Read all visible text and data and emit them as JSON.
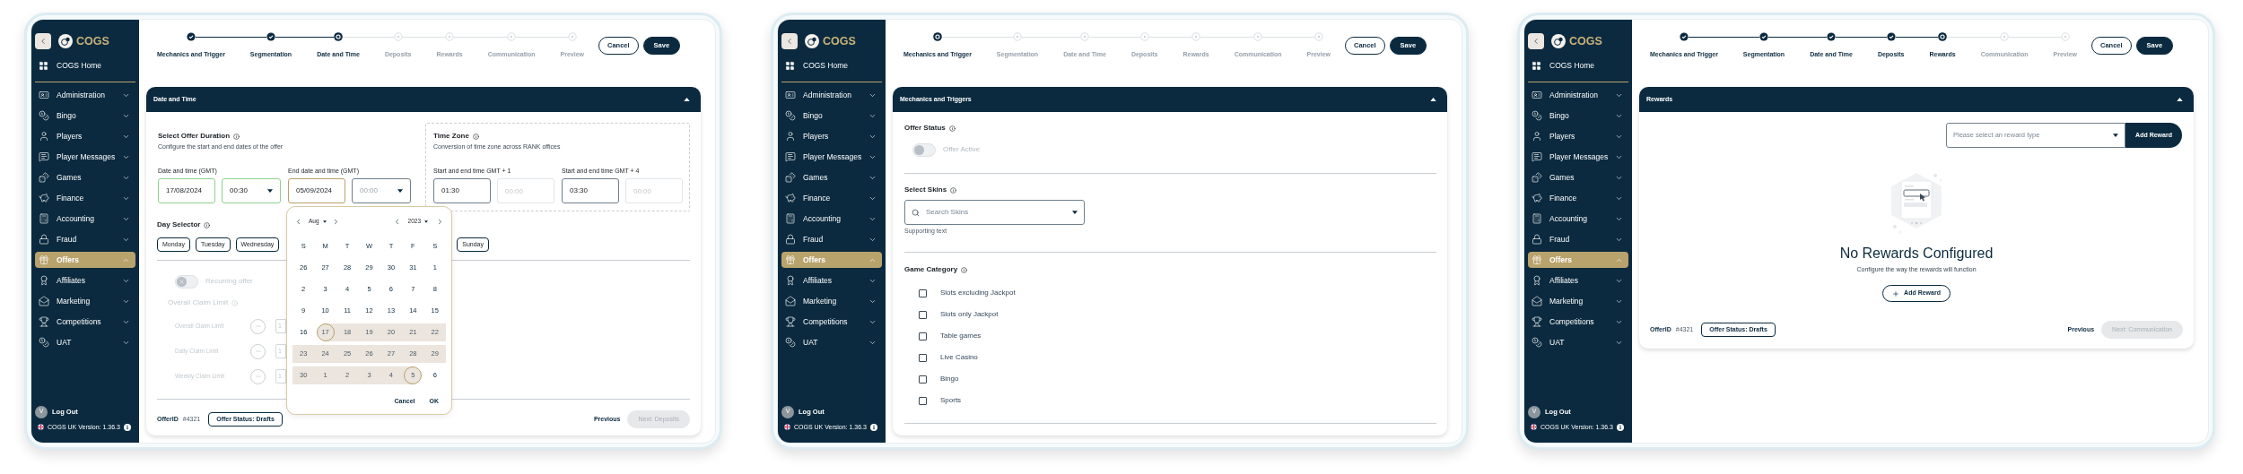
{
  "screens": [
    {
      "sidebar": {
        "brand": "COGS",
        "home": "COGS Home",
        "items": [
          {
            "label": "Administration",
            "selected": false,
            "expanded": false
          },
          {
            "label": "Bingo",
            "selected": false,
            "expanded": false
          },
          {
            "label": "Players",
            "selected": false,
            "expanded": false
          },
          {
            "label": "Player Messages",
            "selected": false,
            "expanded": false
          },
          {
            "label": "Games",
            "selected": false,
            "expanded": false
          },
          {
            "label": "Finance",
            "selected": false,
            "expanded": false
          },
          {
            "label": "Accounting",
            "selected": false,
            "expanded": false
          },
          {
            "label": "Fraud",
            "selected": false,
            "expanded": false
          },
          {
            "label": "Offers",
            "selected": true,
            "expanded": true
          },
          {
            "label": "Affiliates",
            "selected": false,
            "expanded": false
          },
          {
            "label": "Marketing",
            "selected": false,
            "expanded": false
          },
          {
            "label": "Competitions",
            "selected": false,
            "expanded": false
          },
          {
            "label": "UAT",
            "selected": false,
            "expanded": false
          }
        ],
        "user": {
          "initial": "V",
          "action": "Log Out"
        },
        "version": "COGS UK Version: 1.36.3"
      },
      "stepper": [
        {
          "label": "Mechanics and Trigger",
          "kind": "done"
        },
        {
          "label": "Segmentation",
          "kind": "done"
        },
        {
          "label": "Date and Time",
          "kind": "current"
        },
        {
          "label": "Deposits",
          "kind": "todo"
        },
        {
          "label": "Rewards",
          "kind": "todo"
        },
        {
          "label": "Communication",
          "kind": "todo"
        },
        {
          "label": "Preview",
          "kind": "todo"
        }
      ],
      "actions": [
        {
          "label": "Cancel",
          "kind": "secondary"
        },
        {
          "label": "Save",
          "kind": "primary"
        }
      ],
      "card": {
        "kind": "date_time",
        "title": "Date and Time",
        "expanded": true,
        "duration": {
          "title": "Select Offer Duration",
          "subtitle": "Configure the start and end dates of the offer",
          "groups": [
            {
              "label": "Date and time (GMT)",
              "date": {
                "value": "17/08/2024",
                "valid": true,
                "focused": false
              },
              "time": {
                "value": "00:30",
                "valid": true,
                "focused": false
              }
            },
            {
              "label": "End date and time (GMT)",
              "date": {
                "value": "05/09/2024",
                "focused": true
              },
              "time": {
                "placeholder": "00:00",
                "valid": false,
                "focused": false
              }
            }
          ]
        },
        "timezone": {
          "title": "Time Zone",
          "subtitle": "Conversion of time zone across RANK offices",
          "groups": [
            {
              "label": "Start and end time GMT + 1",
              "start": "01:30",
              "end_placeholder": "00:00"
            },
            {
              "label": "Start and end time GMT + 4",
              "start": "03:30",
              "end_placeholder": "00:00"
            }
          ]
        },
        "day_selector": {
          "title": "Day Selector",
          "days": [
            "Monday",
            "Tuesday",
            "Wednesday",
            "Sunday"
          ]
        },
        "recurring": {
          "label": "Recurring offer",
          "on": false,
          "disabled": true
        },
        "claim_limits": {
          "title": "Overall Claim Limit",
          "disabled": true,
          "rows": [
            {
              "label": "Overall Claim Limit",
              "value": "1"
            },
            {
              "label": "Daily Claim Limit",
              "value": "1"
            },
            {
              "label": "Weekly Claim Limit",
              "value": "1"
            }
          ]
        },
        "calendar": {
          "month": "Aug",
          "year": "2023",
          "weekdays": [
            "S",
            "M",
            "T",
            "W",
            "T",
            "F",
            "S"
          ],
          "weeks": [
            [
              {
                "day": "26",
                "kind": "plain"
              },
              {
                "day": "27",
                "kind": "plain"
              },
              {
                "day": "28",
                "kind": "plain"
              },
              {
                "day": "29",
                "kind": "plain"
              },
              {
                "day": "30",
                "kind": "plain"
              },
              {
                "day": "31",
                "kind": "plain"
              },
              {
                "day": "1",
                "kind": "plain"
              }
            ],
            [
              {
                "day": "2",
                "kind": "plain"
              },
              {
                "day": "3",
                "kind": "plain"
              },
              {
                "day": "4",
                "kind": "plain"
              },
              {
                "day": "5",
                "kind": "plain"
              },
              {
                "day": "6",
                "kind": "plain"
              },
              {
                "day": "7",
                "kind": "plain"
              },
              {
                "day": "8",
                "kind": "plain"
              }
            ],
            [
              {
                "day": "9",
                "kind": "plain"
              },
              {
                "day": "10",
                "kind": "plain"
              },
              {
                "day": "11",
                "kind": "plain"
              },
              {
                "day": "12",
                "kind": "plain"
              },
              {
                "day": "13",
                "kind": "plain"
              },
              {
                "day": "14",
                "kind": "plain"
              },
              {
                "day": "15",
                "kind": "plain"
              }
            ],
            [
              {
                "day": "16",
                "kind": "plain"
              },
              {
                "day": "17",
                "kind": "start"
              },
              {
                "day": "18",
                "kind": "mid"
              },
              {
                "day": "19",
                "kind": "mid"
              },
              {
                "day": "20",
                "kind": "mid"
              },
              {
                "day": "21",
                "kind": "mid"
              },
              {
                "day": "22",
                "kind": "mid"
              }
            ],
            [
              {
                "day": "23",
                "kind": "mid"
              },
              {
                "day": "24",
                "kind": "mid"
              },
              {
                "day": "25",
                "kind": "mid"
              },
              {
                "day": "26",
                "kind": "mid"
              },
              {
                "day": "27",
                "kind": "mid"
              },
              {
                "day": "28",
                "kind": "mid"
              },
              {
                "day": "29",
                "kind": "mid"
              }
            ],
            [
              {
                "day": "30",
                "kind": "mid"
              },
              {
                "day": "1",
                "kind": "mid"
              },
              {
                "day": "2",
                "kind": "mid"
              },
              {
                "day": "3",
                "kind": "mid"
              },
              {
                "day": "4",
                "kind": "mid"
              },
              {
                "day": "5",
                "kind": "end"
              },
              {
                "day": "6",
                "kind": "plain"
              }
            ]
          ],
          "buttons": [
            "Cancel",
            "OK"
          ]
        },
        "footer": {
          "offer_id_label": "OfferID",
          "offer_id": "#4321",
          "status": "Offer Status: Drafts",
          "previous": "Previous",
          "next": {
            "label": "Next: Deposits",
            "disabled": true
          }
        }
      }
    },
    {
      "sidebar": {
        "brand": "COGS",
        "home": "COGS Home",
        "items": [
          {
            "label": "Administration",
            "selected": false,
            "expanded": false
          },
          {
            "label": "Bingo",
            "selected": false,
            "expanded": false
          },
          {
            "label": "Players",
            "selected": false,
            "expanded": false
          },
          {
            "label": "Player Messages",
            "selected": false,
            "expanded": false
          },
          {
            "label": "Games",
            "selected": false,
            "expanded": false
          },
          {
            "label": "Finance",
            "selected": false,
            "expanded": false
          },
          {
            "label": "Accounting",
            "selected": false,
            "expanded": false
          },
          {
            "label": "Fraud",
            "selected": false,
            "expanded": false
          },
          {
            "label": "Offers",
            "selected": true,
            "expanded": true
          },
          {
            "label": "Affiliates",
            "selected": false,
            "expanded": false
          },
          {
            "label": "Marketing",
            "selected": false,
            "expanded": false
          },
          {
            "label": "Competitions",
            "selected": false,
            "expanded": false
          },
          {
            "label": "UAT",
            "selected": false,
            "expanded": false
          }
        ],
        "user": {
          "initial": "V",
          "action": "Log Out"
        },
        "version": "COGS UK Version: 1.36.3"
      },
      "stepper": [
        {
          "label": "Mechanics and Trigger",
          "kind": "current"
        },
        {
          "label": "Segmentation",
          "kind": "todo"
        },
        {
          "label": "Date and Time",
          "kind": "todo"
        },
        {
          "label": "Deposits",
          "kind": "todo"
        },
        {
          "label": "Rewards",
          "kind": "todo"
        },
        {
          "label": "Communication",
          "kind": "todo"
        },
        {
          "label": "Preview",
          "kind": "todo"
        }
      ],
      "actions": [
        {
          "label": "Cancel",
          "kind": "secondary"
        },
        {
          "label": "Save",
          "kind": "primary"
        }
      ],
      "card": {
        "kind": "mechanics",
        "title": "Mechanics and Triggers",
        "expanded": true,
        "offer_status": {
          "title": "Offer Status",
          "toggle": {
            "label": "Offer Active",
            "on": false
          }
        },
        "skins": {
          "title": "Select Skins",
          "placeholder": "Search Skins",
          "helper": "Supporting text"
        },
        "game_category": {
          "title": "Game Category",
          "options": [
            {
              "label": "Slots excluding Jackpot",
              "checked": false
            },
            {
              "label": "Slots only Jackpot",
              "checked": false
            },
            {
              "label": "Table games",
              "checked": false
            },
            {
              "label": "Live Casino",
              "checked": false
            },
            {
              "label": "Bingo",
              "checked": false
            },
            {
              "label": "Sports",
              "checked": false
            }
          ]
        }
      }
    },
    {
      "sidebar": {
        "brand": "COGS",
        "home": "COGS Home",
        "items": [
          {
            "label": "Administration",
            "selected": false,
            "expanded": false
          },
          {
            "label": "Bingo",
            "selected": false,
            "expanded": false
          },
          {
            "label": "Players",
            "selected": false,
            "expanded": false
          },
          {
            "label": "Player Messages",
            "selected": false,
            "expanded": false
          },
          {
            "label": "Games",
            "selected": false,
            "expanded": false
          },
          {
            "label": "Finance",
            "selected": false,
            "expanded": false
          },
          {
            "label": "Accounting",
            "selected": false,
            "expanded": false
          },
          {
            "label": "Fraud",
            "selected": false,
            "expanded": false
          },
          {
            "label": "Offers",
            "selected": true,
            "expanded": true
          },
          {
            "label": "Affiliates",
            "selected": false,
            "expanded": false
          },
          {
            "label": "Marketing",
            "selected": false,
            "expanded": false
          },
          {
            "label": "Competitions",
            "selected": false,
            "expanded": false
          },
          {
            "label": "UAT",
            "selected": false,
            "expanded": false
          }
        ],
        "user": {
          "initial": "V",
          "action": "Log Out"
        },
        "version": "COGS UK Version: 1.36.3"
      },
      "stepper": [
        {
          "label": "Mechanics and Trigger",
          "kind": "done"
        },
        {
          "label": "Segmentation",
          "kind": "done"
        },
        {
          "label": "Date and Time",
          "kind": "done"
        },
        {
          "label": "Deposits",
          "kind": "done"
        },
        {
          "label": "Rewards",
          "kind": "current"
        },
        {
          "label": "Communication",
          "kind": "todo"
        },
        {
          "label": "Preview",
          "kind": "todo"
        }
      ],
      "actions": [
        {
          "label": "Cancel",
          "kind": "secondary"
        },
        {
          "label": "Save",
          "kind": "primary"
        }
      ],
      "card": {
        "kind": "rewards",
        "title": "Rewards",
        "expanded": true,
        "select": {
          "placeholder": "Please select an reward type"
        },
        "add_button": "Add Reward",
        "empty": {
          "title": "No Rewards Configured",
          "subtitle": "Configure the way the rewards will function",
          "button": "Add Reward"
        },
        "footer": {
          "offer_id_label": "OfferID",
          "offer_id": "#4321",
          "status": "Offer Status: Drafts",
          "previous": "Previous",
          "next": {
            "label": "Next: Communication",
            "disabled": true
          }
        }
      }
    }
  ]
}
